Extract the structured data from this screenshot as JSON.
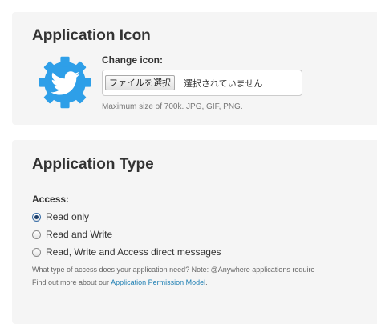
{
  "application_icon": {
    "title": "Application Icon",
    "icon": "twitter-bird-gear-icon",
    "change_label": "Change icon:",
    "file_button_label": "ファイルを選択",
    "file_status": "選択されていません",
    "size_hint": "Maximum size of 700k. JPG, GIF, PNG."
  },
  "application_type": {
    "title": "Application Type",
    "access_label": "Access:",
    "options": [
      {
        "label": "Read only",
        "checked": true
      },
      {
        "label": "Read and Write",
        "checked": false
      },
      {
        "label": "Read, Write and Access direct messages",
        "checked": false
      }
    ],
    "note": "What type of access does your application need? Note: @Anywhere applications require",
    "permission_prefix": "Find out more about our ",
    "permission_link": "Application Permission Model",
    "permission_suffix": "."
  },
  "colors": {
    "panel_background": "#f5f5f5",
    "link": "#1f7fb3",
    "icon_blue": "#2e9fe8"
  }
}
